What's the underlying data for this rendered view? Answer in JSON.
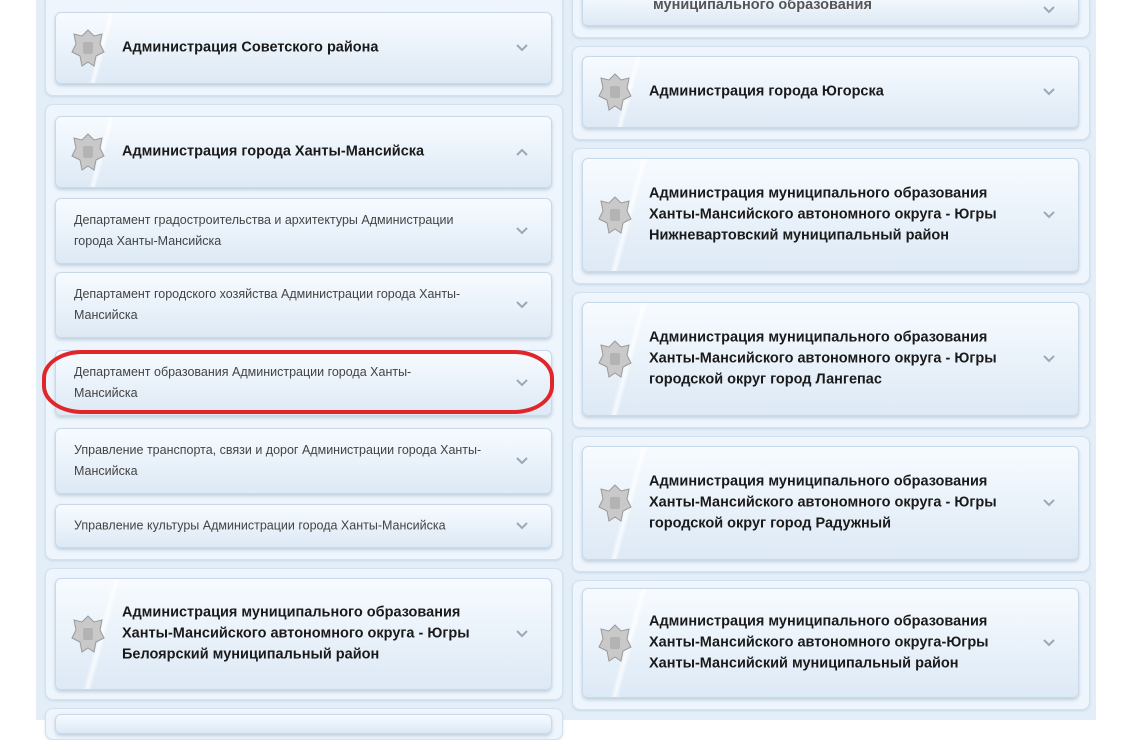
{
  "left_column": {
    "sovetsky": "Администрация Советского района",
    "khanty_city": "Администрация города Ханты-Мансийска",
    "departments": [
      "Департамент градостроительства и архитектуры Администрации города Ханты-Мансийска",
      "Департамент городского хозяйства Администрации города Ханты-Мансийска",
      "Департамент образования Администрации города Ханты-Мансийска",
      "Управление транспорта, связи и дорог Администрации города Ханты-Мансийска",
      "Управление культуры Администрации города Ханты-Мансийска"
    ],
    "beloyarsky": "Администрация муниципального образования Ханты-Мансийского автономного округа - Югры Белоярский муниципальный район"
  },
  "right_column": {
    "top_partial": "муниципального образования",
    "yugorsk": "Администрация города Югорска",
    "nizhnevartovsk": "Администрация муниципального образования Ханты-Мансийского автономного округа - Югры Нижневартовский муниципальный район",
    "langepas": "Администрация муниципального образования Ханты-Мансийского автономного округа - Югры городской округ город Лангепас",
    "raduzhny": "Администрация муниципального образования Ханты-Мансийского автономного округа - Югры городской округ город Радужный",
    "khanty_district": "Администрация муниципального образования Ханты-Мансийского автономного округа-Югры Ханты-Мансийский муниципальный район"
  },
  "colors": {
    "highlight": "#e0262a",
    "tile_border": "#c9d9e9",
    "page_bg": "#e4eef8"
  },
  "icons": {
    "emblem": "russian-coat-of-arms-icon",
    "chevron_down": "chevron-down-icon",
    "chevron_up": "chevron-up-icon"
  }
}
